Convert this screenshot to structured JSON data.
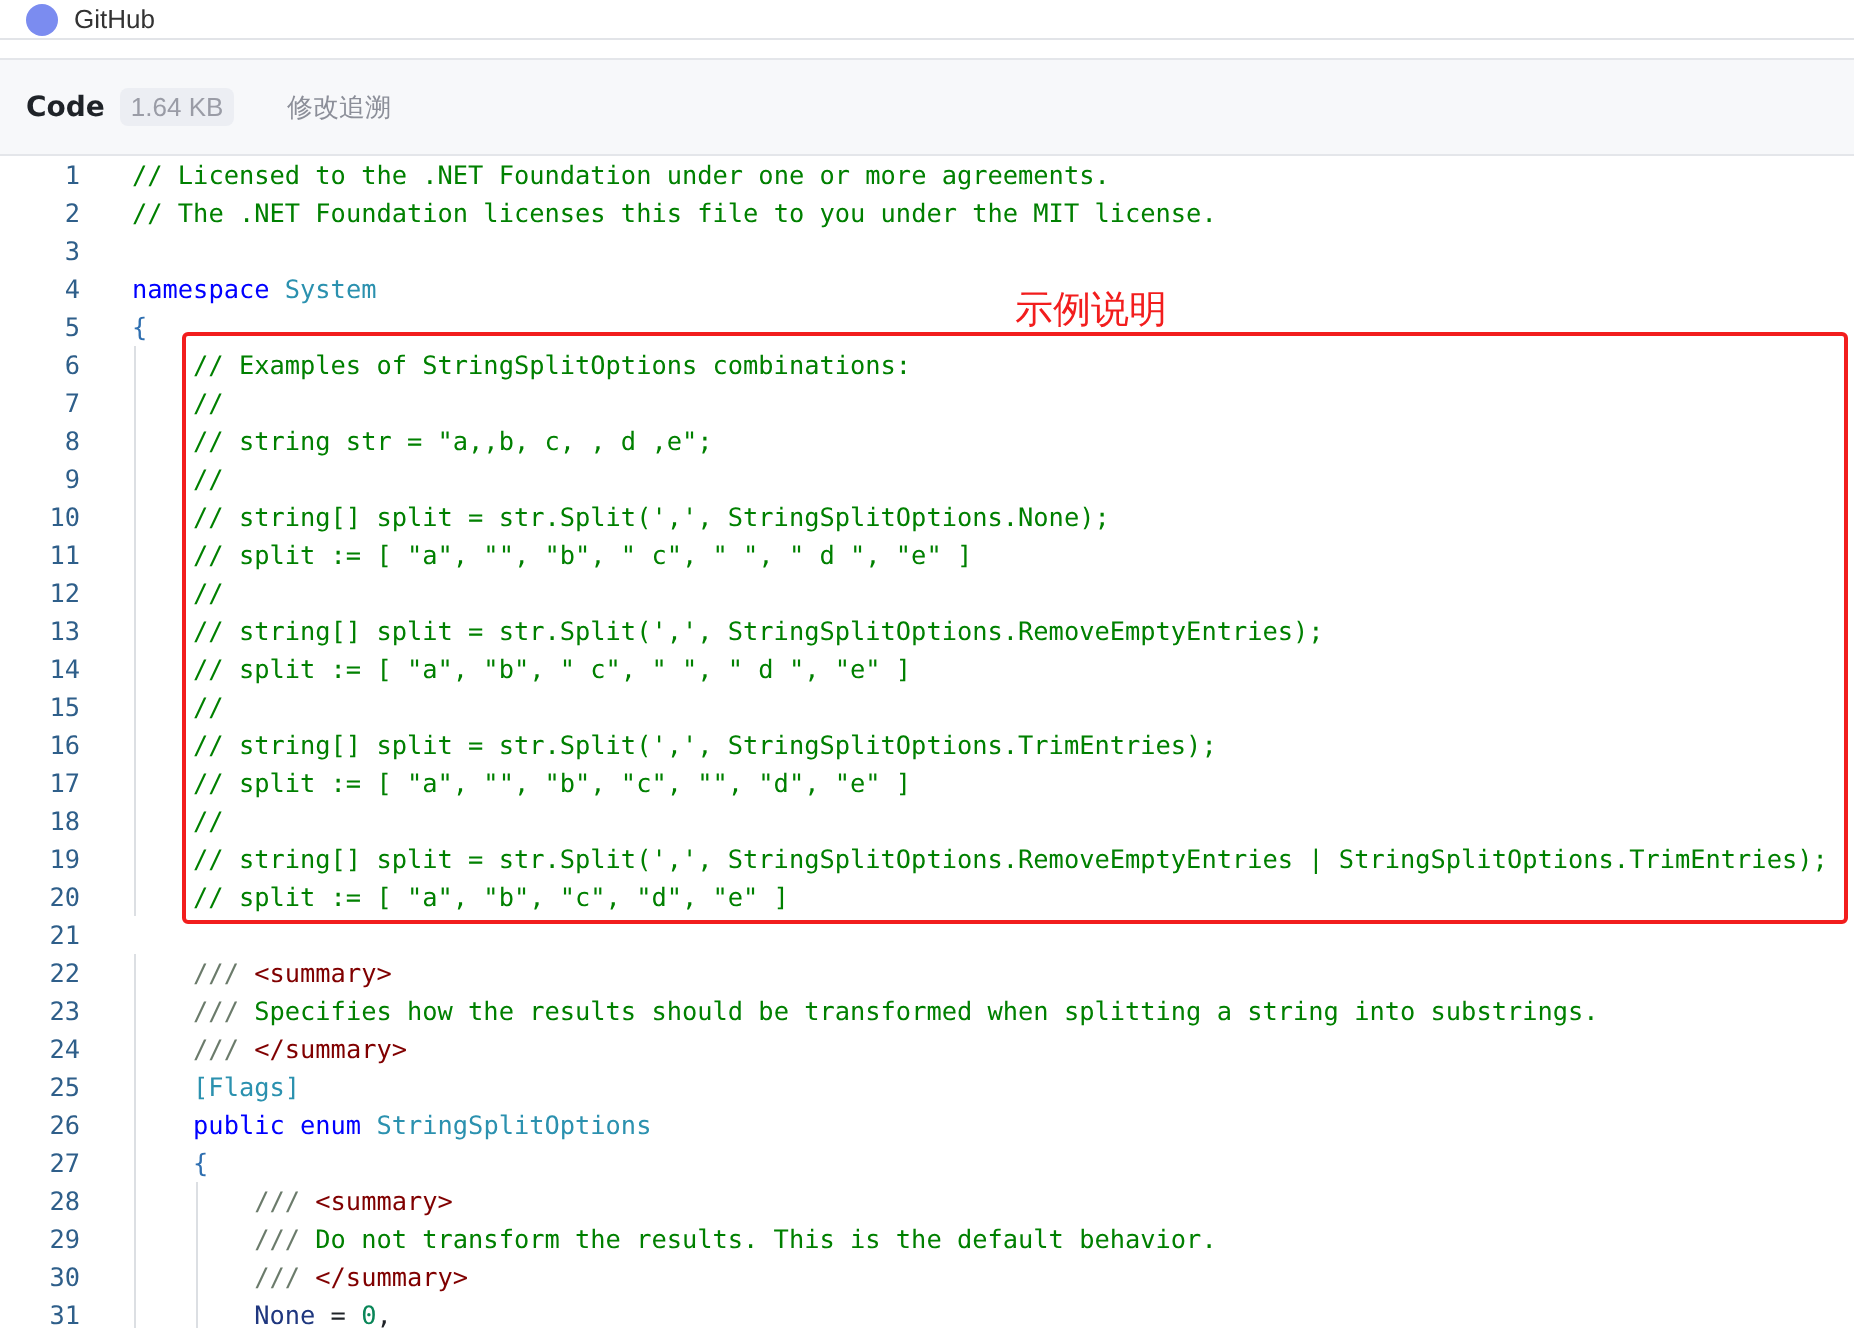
{
  "top_bar": {
    "title": "GitHub"
  },
  "file_header": {
    "tabs": [
      {
        "label": "Code",
        "selected": true,
        "badge": "1.64 KB"
      },
      {
        "label": "修改追溯",
        "selected": false
      }
    ]
  },
  "code": {
    "blocks": [
      {
        "kind": "plain",
        "lines": [
          {
            "number": "1",
            "tokens": [
              {
                "kind": "comment",
                "text": "// Licensed to the .NET Foundation under one or more agreements."
              }
            ]
          },
          {
            "number": "2",
            "tokens": [
              {
                "kind": "comment",
                "text": "// The .NET Foundation licenses this file to you under the MIT license."
              }
            ]
          },
          {
            "number": "3"
          },
          {
            "number": "4",
            "tokens": [
              {
                "kind": "keyword",
                "text": "namespace "
              },
              {
                "kind": "type",
                "text": "System"
              }
            ]
          },
          {
            "number": "5",
            "tokens": [
              {
                "kind": "punct",
                "text": "{"
              }
            ]
          }
        ]
      },
      {
        "kind": "annotated",
        "label": "示例说明",
        "lines": [
          {
            "number": "6",
            "tokens": [
              {
                "kind": "comment",
                "text": "    // Examples of StringSplitOptions combinations:"
              }
            ]
          },
          {
            "number": "7",
            "tokens": [
              {
                "kind": "comment",
                "text": "    //"
              }
            ]
          },
          {
            "number": "8",
            "tokens": [
              {
                "kind": "comment",
                "text": "    // string str = \"a,,b, c, , d ,e\";"
              }
            ]
          },
          {
            "number": "9",
            "tokens": [
              {
                "kind": "comment",
                "text": "    //"
              }
            ]
          },
          {
            "number": "10",
            "tokens": [
              {
                "kind": "comment",
                "text": "    // string[] split = str.Split(',', StringSplitOptions.None);"
              }
            ]
          },
          {
            "number": "11",
            "tokens": [
              {
                "kind": "comment",
                "text": "    // split := [ \"a\", \"\", \"b\", \" c\", \" \", \" d \", \"e\" ]"
              }
            ]
          },
          {
            "number": "12",
            "tokens": [
              {
                "kind": "comment",
                "text": "    //"
              }
            ]
          },
          {
            "number": "13",
            "tokens": [
              {
                "kind": "comment",
                "text": "    // string[] split = str.Split(',', StringSplitOptions.RemoveEmptyEntries);"
              }
            ]
          },
          {
            "number": "14",
            "tokens": [
              {
                "kind": "comment",
                "text": "    // split := [ \"a\", \"b\", \" c\", \" \", \" d \", \"e\" ]"
              }
            ]
          },
          {
            "number": "15",
            "tokens": [
              {
                "kind": "comment",
                "text": "    //"
              }
            ]
          },
          {
            "number": "16",
            "tokens": [
              {
                "kind": "comment",
                "text": "    // string[] split = str.Split(',', StringSplitOptions.TrimEntries);"
              }
            ]
          },
          {
            "number": "17",
            "tokens": [
              {
                "kind": "comment",
                "text": "    // split := [ \"a\", \"\", \"b\", \"c\", \"\", \"d\", \"e\" ]"
              }
            ]
          },
          {
            "number": "18",
            "tokens": [
              {
                "kind": "comment",
                "text": "    //"
              }
            ]
          },
          {
            "number": "19",
            "tokens": [
              {
                "kind": "comment",
                "text": "    // string[] split = str.Split(',', StringSplitOptions.RemoveEmptyEntries | StringSplitOptions.TrimEntries);"
              }
            ]
          },
          {
            "number": "20",
            "tokens": [
              {
                "kind": "comment",
                "text": "    // split := [ \"a\", \"b\", \"c\", \"d\", \"e\" ]"
              }
            ]
          }
        ]
      },
      {
        "kind": "plain",
        "lines": [
          {
            "number": "21"
          },
          {
            "number": "22",
            "tokens": [
              {
                "kind": "doc",
                "text": "    /// "
              },
              {
                "kind": "tag",
                "text": "<summary>"
              }
            ]
          },
          {
            "number": "23",
            "tokens": [
              {
                "kind": "doc",
                "text": "    ///"
              },
              {
                "kind": "comment",
                "text": " Specifies how the results should be transformed when splitting a string into substrings."
              }
            ]
          },
          {
            "number": "24",
            "tokens": [
              {
                "kind": "doc",
                "text": "    /// "
              },
              {
                "kind": "tag",
                "text": "</summary>"
              }
            ]
          },
          {
            "number": "25",
            "tokens": [
              {
                "kind": "attr",
                "text": "    [Flags]"
              }
            ]
          },
          {
            "number": "26",
            "tokens": [
              {
                "kind": "keyword",
                "text": "    public enum "
              },
              {
                "kind": "type",
                "text": "StringSplitOptions"
              }
            ]
          },
          {
            "number": "27",
            "tokens": [
              {
                "kind": "punct",
                "text": "    {"
              }
            ]
          },
          {
            "number": "28",
            "tokens": [
              {
                "kind": "doc",
                "text": "        /// "
              },
              {
                "kind": "tag",
                "text": "<summary>"
              }
            ]
          },
          {
            "number": "29",
            "tokens": [
              {
                "kind": "doc",
                "text": "        ///"
              },
              {
                "kind": "comment",
                "text": " Do not transform the results. This is the default behavior."
              }
            ]
          },
          {
            "number": "30",
            "tokens": [
              {
                "kind": "doc",
                "text": "        /// "
              },
              {
                "kind": "tag",
                "text": "</summary>"
              }
            ]
          },
          {
            "number": "31",
            "tokens": [
              {
                "kind": "ident",
                "text": "        None"
              },
              {
                "kind": "plain",
                "text": " = "
              },
              {
                "kind": "number",
                "text": "0"
              },
              {
                "kind": "plain",
                "text": ","
              }
            ]
          }
        ]
      }
    ]
  }
}
